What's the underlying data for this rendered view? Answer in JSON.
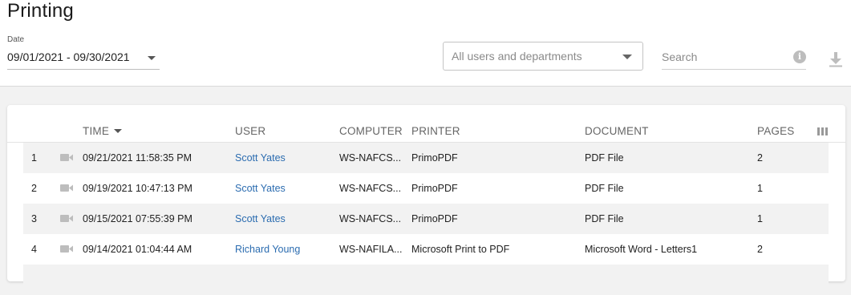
{
  "page": {
    "title": "Printing"
  },
  "filters": {
    "date_label": "Date",
    "date_range": "09/01/2021 - 09/30/2021",
    "users_placeholder": "All users and departments",
    "search_placeholder": "Search"
  },
  "table": {
    "columns": {
      "time": "TIME",
      "user": "USER",
      "computer": "COMPUTER",
      "printer": "PRINTER",
      "document": "DOCUMENT",
      "pages": "PAGES"
    },
    "rows": [
      {
        "index": "1",
        "time": "09/21/2021 11:58:35 PM",
        "user": "Scott Yates",
        "computer": "WS-NAFCS...",
        "printer": "PrimoPDF",
        "document": "PDF File",
        "pages": "2"
      },
      {
        "index": "2",
        "time": "09/19/2021 10:47:13 PM",
        "user": "Scott Yates",
        "computer": "WS-NAFCS...",
        "printer": "PrimoPDF",
        "document": "PDF File",
        "pages": "1"
      },
      {
        "index": "3",
        "time": "09/15/2021 07:55:39 PM",
        "user": "Scott Yates",
        "computer": "WS-NAFCS...",
        "printer": "PrimoPDF",
        "document": "PDF File",
        "pages": "1"
      },
      {
        "index": "4",
        "time": "09/14/2021 01:04:44 AM",
        "user": "Richard Young",
        "computer": "WS-NAFILA...",
        "printer": "Microsoft Print to PDF",
        "document": "Microsoft Word - Letters1",
        "pages": "2"
      }
    ]
  },
  "colors": {
    "link": "#2b6cb0",
    "row_alt": "#f2f2f2",
    "page_bg": "#f2f2f2"
  },
  "icons": {
    "sort": "caret-down-icon",
    "info": "info-icon",
    "download": "download-icon",
    "columns": "columns-icon",
    "recording": "video-camera-icon"
  }
}
